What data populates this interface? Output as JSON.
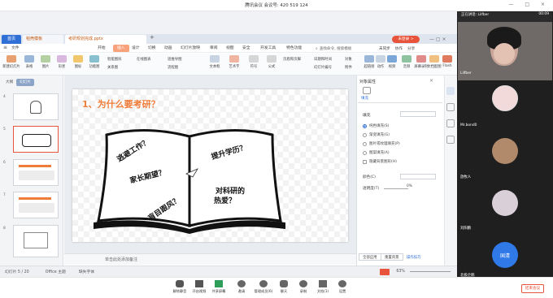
{
  "meeting": {
    "title": "腾讯会议 会议号: 420 519 124",
    "recording_label": "正在讲话: Lilfber",
    "time": "00:09",
    "window_controls": "— □ ×"
  },
  "wps": {
    "tabs": [
      {
        "label": "首页"
      },
      {
        "label": "稻壳模板"
      },
      {
        "label": "考研规划完成.pptx"
      }
    ],
    "new_tab_symbol": "+",
    "login_label": "未登录 >",
    "ribbon_tabs": [
      "文件",
      "开始",
      "插入",
      "设计",
      "切换",
      "动画",
      "幻灯片放映",
      "审阅",
      "视图",
      "安全",
      "开发工具",
      "特色功能"
    ],
    "active_ribbon_tab": "插入",
    "search_placeholder": "查找命令, 搜索模板",
    "top_right": [
      "未同步",
      "协作",
      "分享"
    ],
    "toolbar_items": [
      "新建幻灯片",
      "表格",
      "图片",
      "形状",
      "图标",
      "功能图",
      "智能图形",
      "关系图",
      "在线图表",
      "思维导图",
      "流程图",
      "文本框",
      "艺术字",
      "符号",
      "公式",
      "页眉和页脚",
      "日期和时间",
      "幻灯片编号",
      "对象",
      "附件",
      "超链接",
      "动作",
      "视频",
      "音频",
      "屏幕录制",
      "文档配图",
      "Flash"
    ]
  },
  "thumbs": {
    "tabs": [
      "大纲",
      "幻灯片"
    ],
    "numbers": [
      "4",
      "5",
      "6",
      "7",
      "8"
    ],
    "selected": "5"
  },
  "slide": {
    "title": "1、为什么要考研？",
    "left_page": [
      "逃避工作？",
      "家长期望？",
      "盲目跟风？"
    ],
    "right_page": [
      "提升学历？",
      "对科研的",
      "热爱？"
    ],
    "notes_placeholder": "单击此处添加备注"
  },
  "properties": {
    "header": "对象属性",
    "tab": "填充",
    "section": "填充",
    "options": [
      "纯色填充(S)",
      "渐变填充(G)",
      "图片或纹理填充(P)",
      "图案填充(A)",
      "隐藏背景图形(H)"
    ],
    "color_label": "颜色(C)",
    "transparency_label": "透明度(T)",
    "transparency_value": "0%",
    "apply_all_label": "全部应用",
    "reset_label": "重置背景",
    "reset_bg_label": "操作技巧"
  },
  "statusbar": {
    "slide_count": "幻灯片 5 / 20",
    "theme": "Office 主题",
    "missing_font": "缺失字体",
    "zoom": "63%"
  },
  "participants": [
    {
      "name": "Lilfber",
      "avatar_color": "#caa69a"
    },
    {
      "name": "Mr.bond0",
      "avatar_color": "#f3dada"
    },
    {
      "name": "放牧人",
      "avatar_color": "#b08a6a"
    },
    {
      "name": "刘阳鹏",
      "avatar_color": "#d9cfd8"
    },
    {
      "name": "国清",
      "avatar_color": "#2f79e8"
    },
    {
      "name": "北极企鹅",
      "avatar_color": "#444444"
    }
  ],
  "meeting_toolbar": [
    "解除静音",
    "开启视频",
    "共享屏幕",
    "邀请",
    "管理成员(6)",
    "聊天",
    "录制",
    "文档(1)",
    "设置"
  ],
  "end_meeting_label": "结束会议"
}
